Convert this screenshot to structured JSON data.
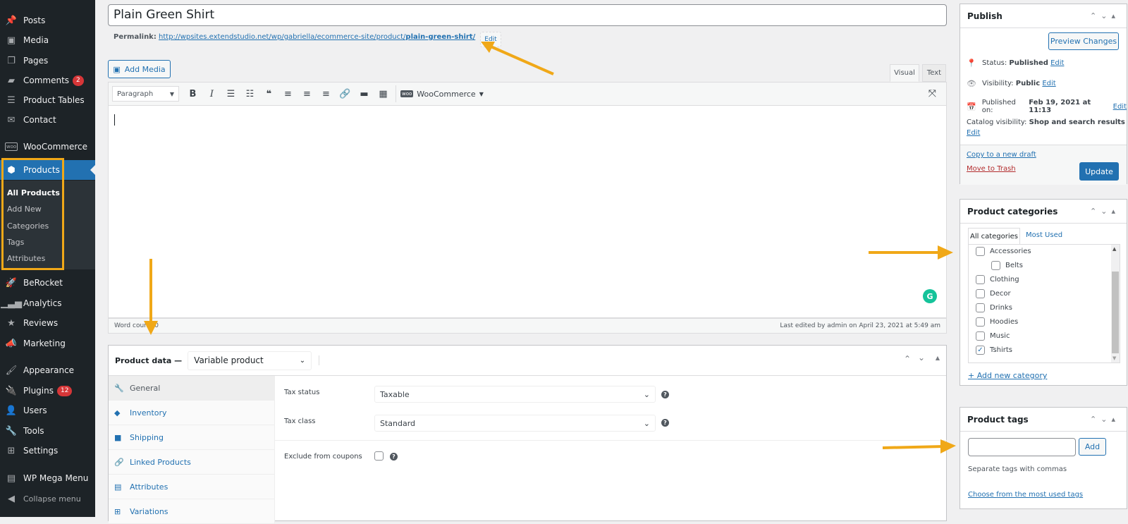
{
  "sidebar": {
    "items": [
      {
        "label": "Posts",
        "icon": "pin-icon"
      },
      {
        "label": "Media",
        "icon": "media-icon"
      },
      {
        "label": "Pages",
        "icon": "pages-icon"
      },
      {
        "label": "Comments",
        "icon": "comment-icon",
        "badge": "2"
      },
      {
        "label": "Product Tables",
        "icon": "list-icon"
      },
      {
        "label": "Contact",
        "icon": "envelope-icon"
      },
      {
        "label": "WooCommerce",
        "icon": "woo-icon"
      },
      {
        "label": "Products",
        "icon": "box-icon"
      },
      {
        "label": "BeRocket",
        "icon": "rocket-icon"
      },
      {
        "label": "Analytics",
        "icon": "bar-chart-icon"
      },
      {
        "label": "Reviews",
        "icon": "star-icon"
      },
      {
        "label": "Marketing",
        "icon": "megaphone-icon"
      },
      {
        "label": "Appearance",
        "icon": "brush-icon"
      },
      {
        "label": "Plugins",
        "icon": "plug-icon",
        "badge": "12"
      },
      {
        "label": "Users",
        "icon": "user-icon"
      },
      {
        "label": "Tools",
        "icon": "wrench-icon"
      },
      {
        "label": "Settings",
        "icon": "settings-icon"
      },
      {
        "label": "WP Mega Menu",
        "icon": "menu-grid-icon"
      },
      {
        "label": "Collapse menu",
        "icon": "collapse-icon"
      }
    ],
    "submenu": [
      "All Products",
      "Add New",
      "Categories",
      "Tags",
      "Attributes"
    ]
  },
  "post": {
    "title": "Plain Green Shirt",
    "permalink_label": "Permalink:",
    "permalink_base": "http://wpsites.extendstudio.net/wp/gabriella/ecommerce-site/product/",
    "permalink_slug": "plain-green-shirt/",
    "permalink_edit": "Edit"
  },
  "editor": {
    "add_media": "Add Media",
    "tab_visual": "Visual",
    "tab_text": "Text",
    "format_select": "Paragraph",
    "woocommerce_menu": "WooCommerce",
    "word_count": "Word count: 0",
    "last_edited": "Last edited by admin on April 23, 2021 at 5:49 am"
  },
  "product_data": {
    "title": "Product data —",
    "type": "Variable product",
    "tabs": [
      "General",
      "Inventory",
      "Shipping",
      "Linked Products",
      "Attributes",
      "Variations"
    ],
    "fields": {
      "tax_status_label": "Tax status",
      "tax_status_value": "Taxable",
      "tax_class_label": "Tax class",
      "tax_class_value": "Standard",
      "exclude_label": "Exclude from coupons"
    }
  },
  "publish": {
    "title": "Publish",
    "preview": "Preview Changes",
    "status_label": "Status:",
    "status_value": "Published",
    "visibility_label": "Visibility:",
    "visibility_value": "Public",
    "published_label": "Published on:",
    "published_value": "Feb 19, 2021 at 11:13",
    "catalog_label": "Catalog visibility:",
    "catalog_value": "Shop and search results",
    "edit": "Edit",
    "copy_draft": "Copy to a new draft",
    "trash": "Move to Trash",
    "update": "Update"
  },
  "categories": {
    "title": "Product categories",
    "tab_all": "All categories",
    "tab_most": "Most Used",
    "items": [
      {
        "label": "Accessories",
        "checked": false,
        "child": false
      },
      {
        "label": "Belts",
        "checked": false,
        "child": true
      },
      {
        "label": "Clothing",
        "checked": false,
        "child": false
      },
      {
        "label": "Decor",
        "checked": false,
        "child": false
      },
      {
        "label": "Drinks",
        "checked": false,
        "child": false
      },
      {
        "label": "Hoodies",
        "checked": false,
        "child": false
      },
      {
        "label": "Music",
        "checked": false,
        "child": false
      },
      {
        "label": "Tshirts",
        "checked": true,
        "child": false
      }
    ],
    "add_new": "+ Add new category"
  },
  "tags": {
    "title": "Product tags",
    "input_value": "",
    "add": "Add",
    "hint": "Separate tags with commas",
    "choose": "Choose from the most used tags"
  },
  "colors": {
    "accent": "#2271b1",
    "sidebar": "#1d2327",
    "highlight": "#f0a818",
    "badge": "#d63638",
    "trash": "#b32d2e"
  }
}
